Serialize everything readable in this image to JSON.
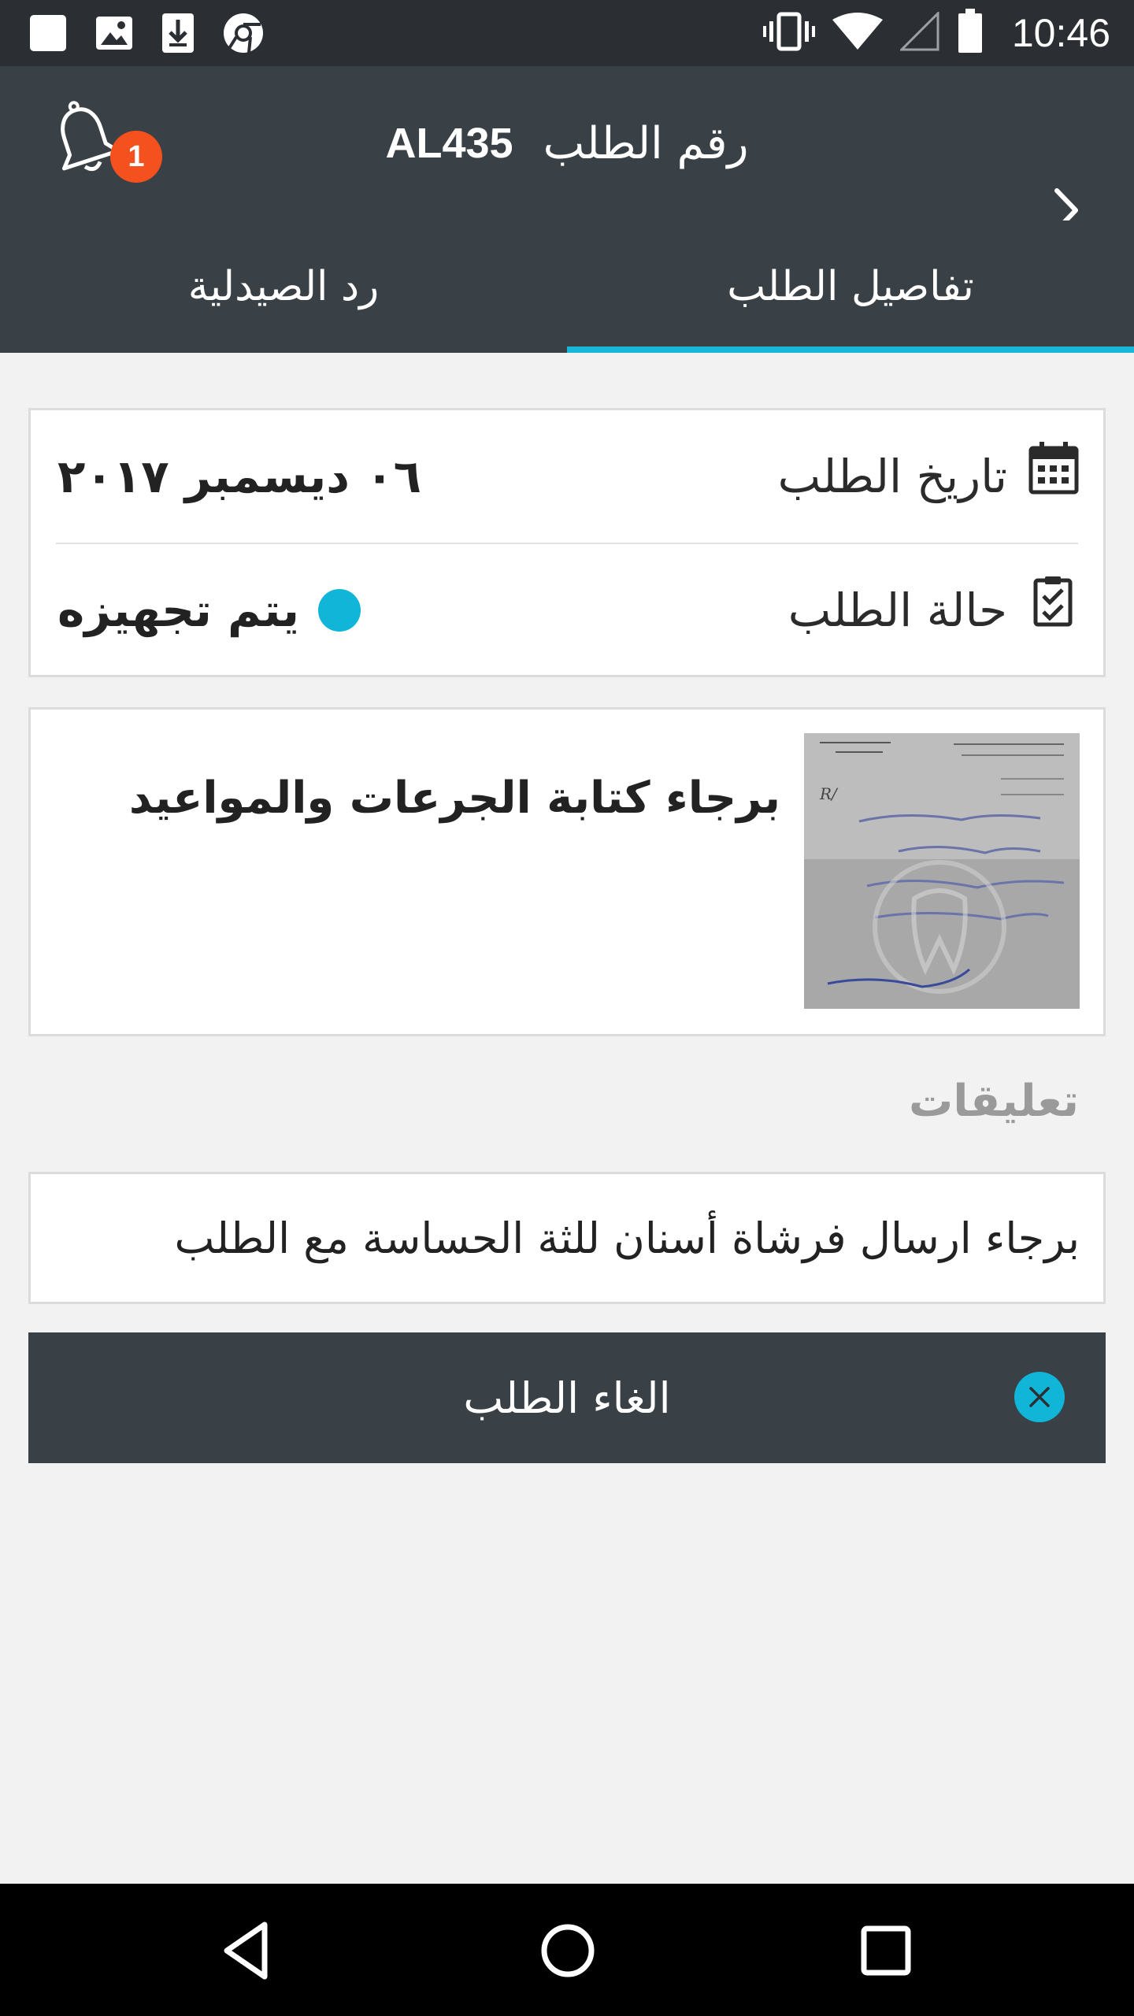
{
  "status_bar": {
    "time": "10:46",
    "icons": [
      "notification-square-icon",
      "image-icon",
      "download-icon",
      "chrome-icon",
      "vibrate-icon",
      "wifi-icon",
      "signal-icon",
      "battery-icon"
    ]
  },
  "app_bar": {
    "order_label": "رقم الطلب",
    "order_id": "AL435",
    "notification_count": "1"
  },
  "tabs": [
    {
      "label": "تفاصيل الطلب",
      "active": true
    },
    {
      "label": "رد الصيدلية",
      "active": false
    }
  ],
  "details": {
    "date_label": "تاريخ الطلب",
    "date_value": "٠٦ ديسمبر ٢٠١٧",
    "status_label": "حالة الطلب",
    "status_value": "يتم تجهيزه",
    "status_color": "#11b5d8"
  },
  "prescription": {
    "note": "برجاء كتابة الجرعات والمواعيد"
  },
  "comments": {
    "title": "تعليقات",
    "text": "برجاء ارسال فرشاة أسنان للثة الحساسة مع الطلب"
  },
  "actions": {
    "cancel_label": "الغاء الطلب"
  },
  "colors": {
    "accent": "#18b6d8",
    "app_bar": "#3a4146",
    "badge": "#f4511e",
    "background": "#f2f2f2"
  }
}
